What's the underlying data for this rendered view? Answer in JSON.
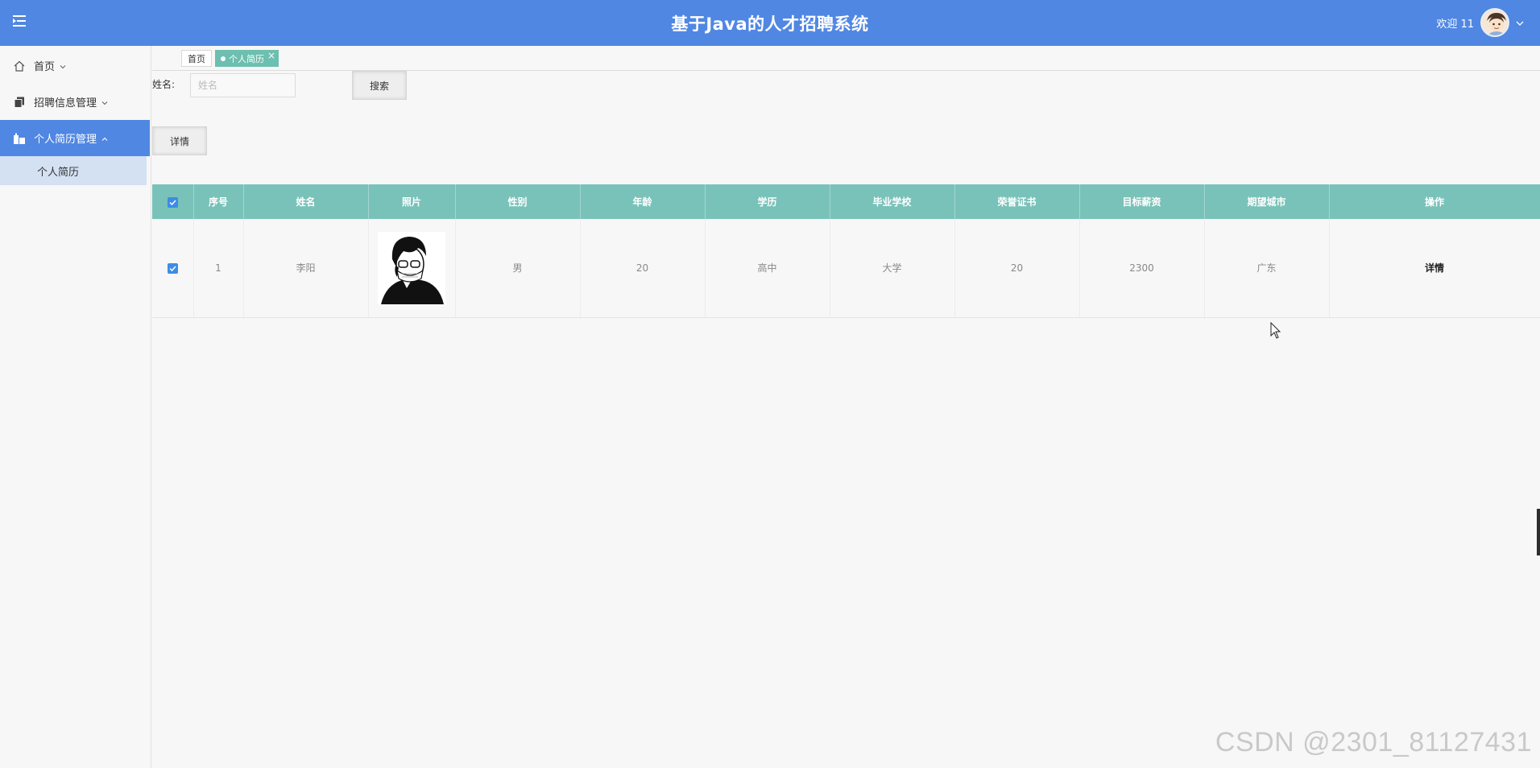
{
  "header": {
    "title": "基于Java的人才招聘系统",
    "welcome": "欢迎 11",
    "menu_icon": "hamburger-icon",
    "accent": "#5087e3"
  },
  "sidebar": {
    "items": [
      {
        "label": "首页",
        "icon": "home-icon",
        "expanded": false
      },
      {
        "label": "招聘信息管理",
        "icon": "documents-icon",
        "expanded": false
      },
      {
        "label": "个人简历管理",
        "icon": "buildings-icon",
        "expanded": true,
        "active": true
      }
    ],
    "sub_items": [
      {
        "label": "个人简历"
      }
    ]
  },
  "tabs": [
    {
      "label": "首页",
      "active": false
    },
    {
      "label": "个人简历",
      "active": true,
      "closable": true
    }
  ],
  "tab_close": "×",
  "search": {
    "label": "姓名:",
    "placeholder": "姓名",
    "value": "",
    "button": "搜索"
  },
  "toolbar": {
    "detail_button": "详情"
  },
  "table": {
    "header_color": "#79c2b9",
    "columns": [
      "序号",
      "姓名",
      "照片",
      "性别",
      "年龄",
      "学历",
      "毕业学校",
      "荣誉证书",
      "目标薪资",
      "期望城市",
      "操作"
    ],
    "rows": [
      {
        "checked": true,
        "index": "1",
        "name": "李阳",
        "photo": "avatar-photo",
        "gender": "男",
        "age": "20",
        "education": "高中",
        "school": "大学",
        "certificate": "20",
        "salary": "2300",
        "city": "广东",
        "action": "详情"
      }
    ]
  },
  "watermark": "CSDN @2301_81127431"
}
